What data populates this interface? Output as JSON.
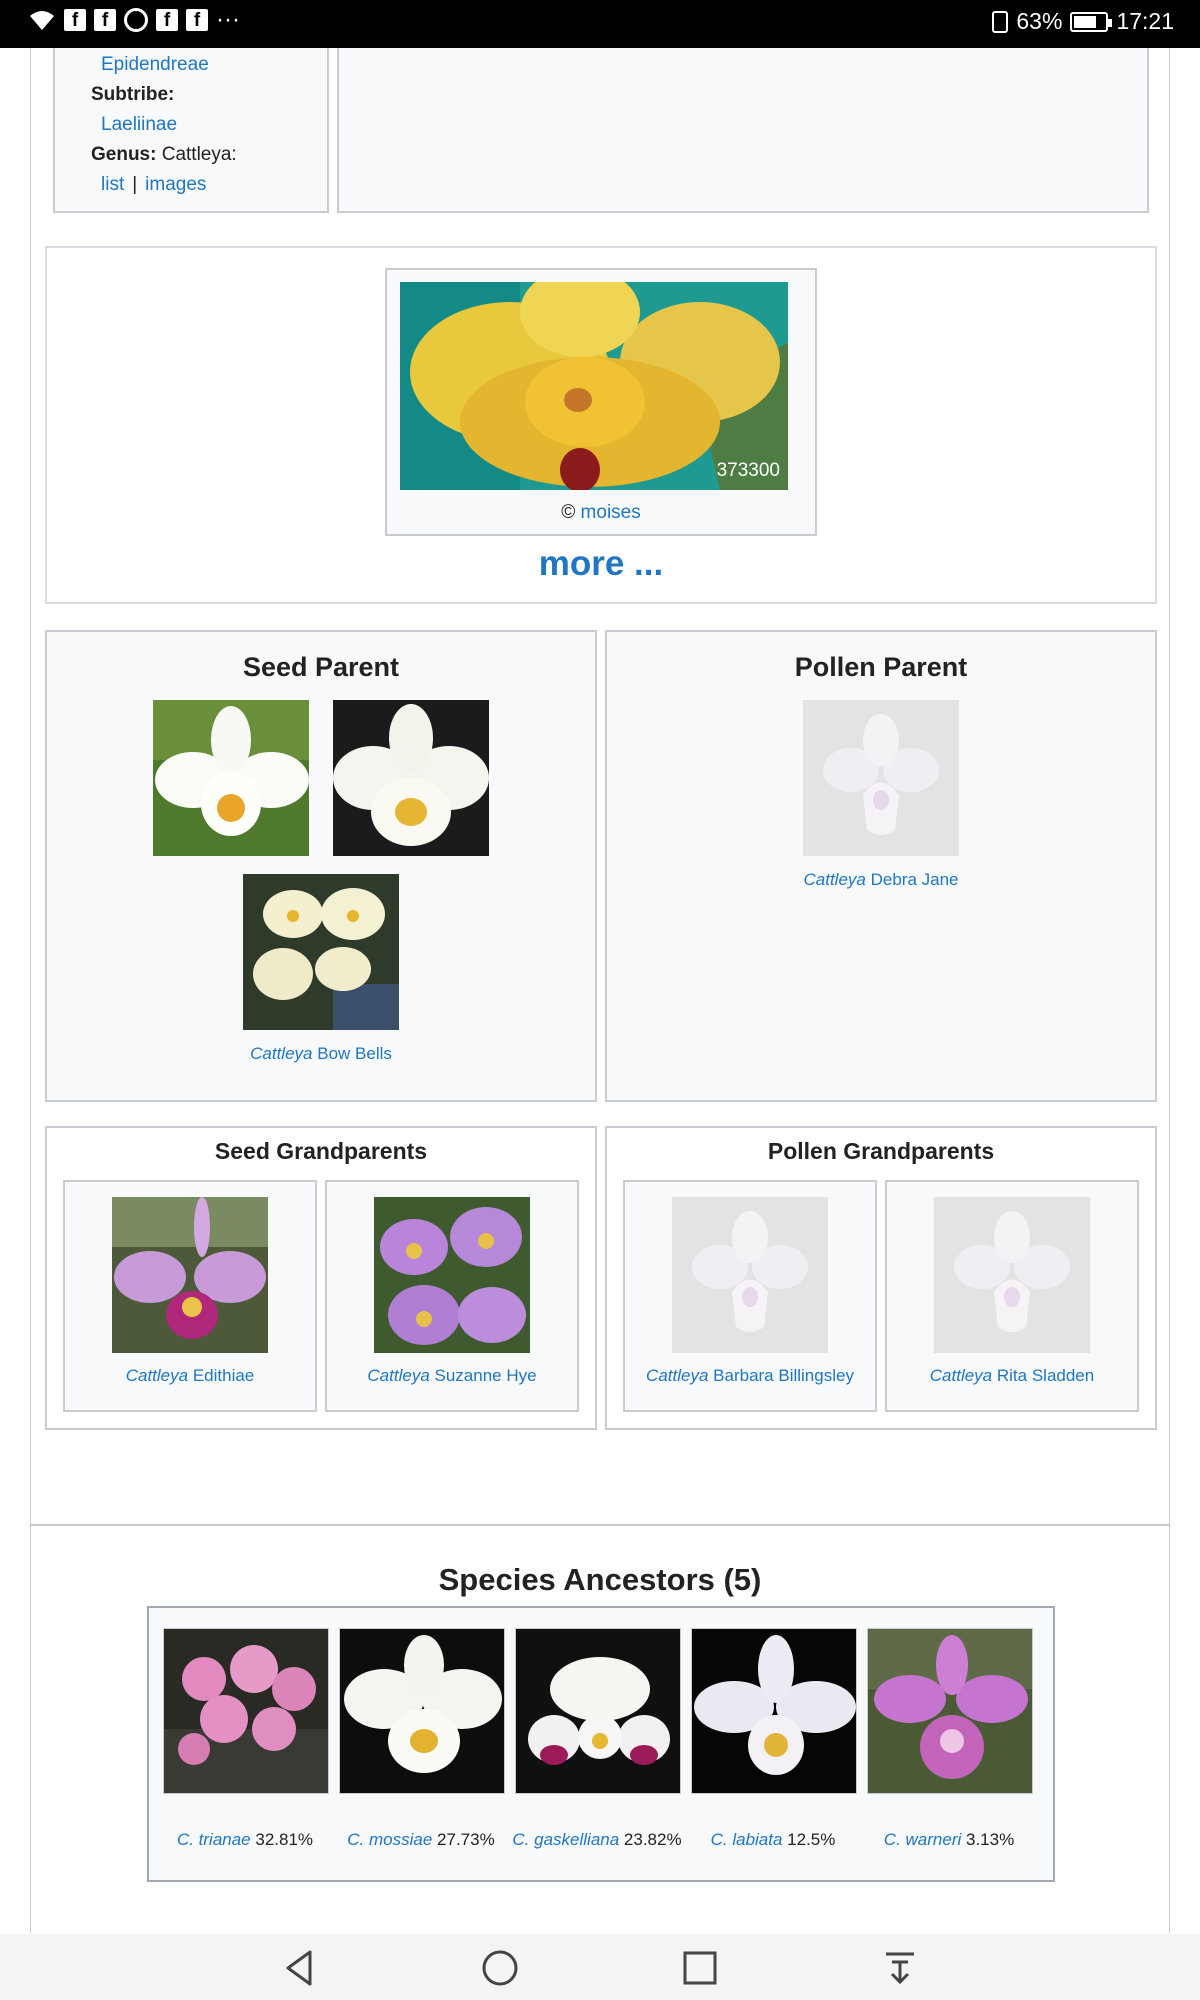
{
  "status_bar": {
    "notification_icons": [
      "wifi-icon",
      "facebook-icon",
      "facebook-icon",
      "whatsapp-icon",
      "facebook-icon",
      "facebook-icon",
      "more-notifications-icon"
    ],
    "more_indicator": "···",
    "battery_percent": "63%",
    "battery_level": 0.63,
    "time": "17:21"
  },
  "taxonomy": {
    "tribe_value": "Epidendreae",
    "subtribe_label": "Subtribe:",
    "subtribe_value": "Laeliinae",
    "genus_label": "Genus:",
    "genus_value": "Cattleya:",
    "list_link": "list",
    "separator": "|",
    "images_link": "images"
  },
  "photo": {
    "id": "373300",
    "copyright": "©",
    "author": "moises",
    "more_link": "more ..."
  },
  "seed_parent": {
    "title": "Seed Parent",
    "genus": "Cattleya",
    "name": "Bow Bells"
  },
  "pollen_parent": {
    "title": "Pollen Parent",
    "genus": "Cattleya",
    "name": "Debra Jane"
  },
  "seed_grandparents": {
    "title": "Seed Grandparents",
    "items": [
      {
        "genus": "Cattleya",
        "name": "Edithiae"
      },
      {
        "genus": "Cattleya",
        "name": "Suzanne Hye"
      }
    ]
  },
  "pollen_grandparents": {
    "title": "Pollen Grandparents",
    "items": [
      {
        "genus": "Cattleya",
        "name": "Barbara Billingsley"
      },
      {
        "genus": "Cattleya",
        "name": "Rita Sladden"
      }
    ]
  },
  "species_ancestors": {
    "title": "Species Ancestors (5)",
    "items": [
      {
        "name": "C. trianae",
        "percent": "32.81%"
      },
      {
        "name": "C. mossiae",
        "percent": "27.73%"
      },
      {
        "name": "C. gaskelliana",
        "percent": "23.82%"
      },
      {
        "name": "C. labiata",
        "percent": "12.5%"
      },
      {
        "name": "C. warneri",
        "percent": "3.13%"
      }
    ]
  },
  "nav_bar": {
    "buttons": [
      "back-icon",
      "home-icon",
      "recents-icon",
      "notification-shade-icon"
    ]
  }
}
